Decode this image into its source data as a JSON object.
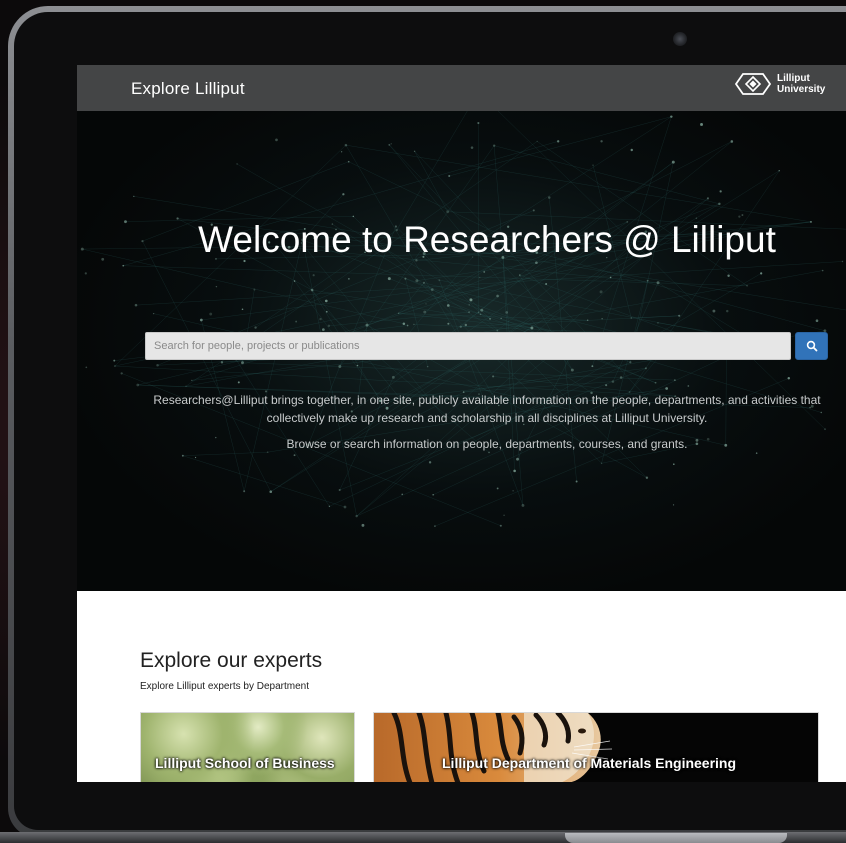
{
  "header": {
    "site_title": "Explore Lilliput",
    "university_logo_line1": "Lilliput",
    "university_logo_line2": "University"
  },
  "hero": {
    "title": "Welcome to Researchers @ Lilliput",
    "search_placeholder": "Search for people, projects or publications",
    "search_button_icon": "search-icon",
    "description": "Researchers@Lilliput brings together, in one site, publicly available information on the people, departments, and activities that collectively make up research and scholarship in all disciplines at Lilliput University.",
    "browse_text": "Browse or search information on people, departments, courses, and grants."
  },
  "experts": {
    "title": "Explore our experts",
    "subtitle": "Explore Lilliput experts by Department",
    "cards": [
      {
        "label": "Lilliput School of Business"
      },
      {
        "label": "Lilliput Department of Materials Engineering"
      }
    ]
  },
  "colors": {
    "topbar": "#444546",
    "hero_background": "#050707",
    "search_button": "#3173b9"
  }
}
